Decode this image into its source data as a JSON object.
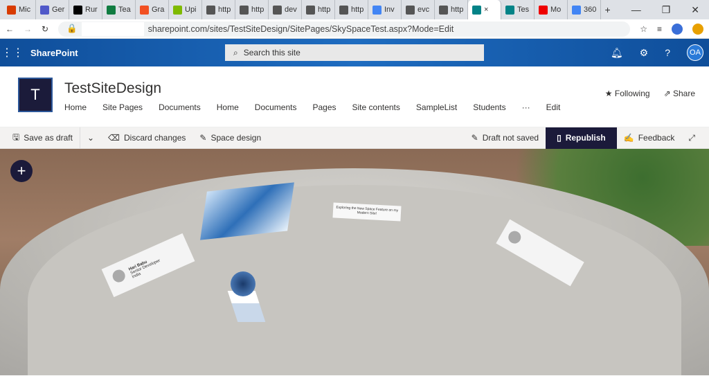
{
  "browser": {
    "tabs": [
      {
        "label": "Mic",
        "color": "#d83b01"
      },
      {
        "label": "Ger",
        "color": "#5059c9"
      },
      {
        "label": "Rur",
        "color": "#000"
      },
      {
        "label": "Tea",
        "color": "#107c41"
      },
      {
        "label": "Gra",
        "color": "#f25022"
      },
      {
        "label": "Upi",
        "color": "#7fba00"
      },
      {
        "label": "http",
        "color": "#555"
      },
      {
        "label": "http",
        "color": "#555"
      },
      {
        "label": "dev",
        "color": "#555"
      },
      {
        "label": "http",
        "color": "#555"
      },
      {
        "label": "http",
        "color": "#555"
      },
      {
        "label": "Inv",
        "color": "#4285f4"
      },
      {
        "label": "evc",
        "color": "#555"
      },
      {
        "label": "http",
        "color": "#555"
      },
      {
        "label": "×",
        "color": "#038387",
        "active": true
      },
      {
        "label": "Tes",
        "color": "#038387"
      },
      {
        "label": "Mo",
        "color": "#e00"
      },
      {
        "label": "360",
        "color": "#4285f4"
      }
    ],
    "url": "sharepoint.com/sites/TestSiteDesign/SitePages/SkySpaceTest.aspx?Mode=Edit"
  },
  "suite": {
    "brand": "SharePoint",
    "search_placeholder": "Search this site",
    "avatar": "OA"
  },
  "site": {
    "logo_letter": "T",
    "title": "TestSiteDesign",
    "nav": [
      "Home",
      "Site Pages",
      "Documents",
      "Home",
      "Documents",
      "Pages",
      "Site contents",
      "SampleList",
      "Students",
      "···",
      "Edit"
    ],
    "following": "Following",
    "share": "Share"
  },
  "command": {
    "save_draft": "Save as draft",
    "discard": "Discard changes",
    "space_design": "Space design",
    "status": "Draft not saved",
    "republish": "Republish",
    "feedback": "Feedback"
  },
  "space": {
    "text_card": "Exploring the New Space Feature on my Modern Site!",
    "person1": {
      "name": "Hari Babu",
      "title": "Senior Developer",
      "location": "India"
    }
  }
}
